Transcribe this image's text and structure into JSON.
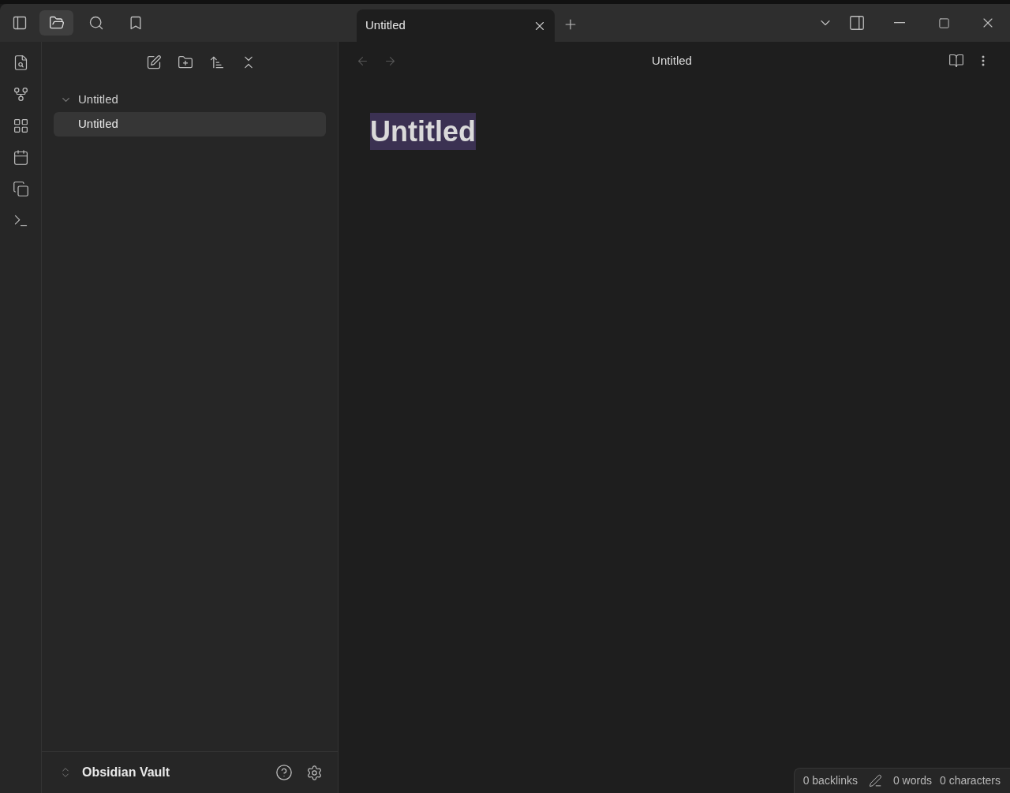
{
  "sidebar_tabs": [
    {
      "kind": "files",
      "selected": true
    },
    {
      "kind": "search",
      "selected": false
    },
    {
      "kind": "bookmarks",
      "selected": false
    }
  ],
  "tabs": [
    {
      "label": "Untitled",
      "selected": true
    }
  ],
  "file_tree": [
    {
      "label": "Untitled",
      "kind": "folder",
      "expanded": true,
      "selected": false,
      "children": [
        {
          "label": "Untitled",
          "kind": "note",
          "selected": true
        }
      ]
    }
  ],
  "view_header": {
    "title": "Untitled"
  },
  "note": {
    "heading": "Untitled",
    "heading_selected": true
  },
  "vault": {
    "name": "Obsidian Vault"
  },
  "status_bar": {
    "backlinks": "0 backlinks",
    "words": "0 words",
    "characters": "0 characters"
  }
}
